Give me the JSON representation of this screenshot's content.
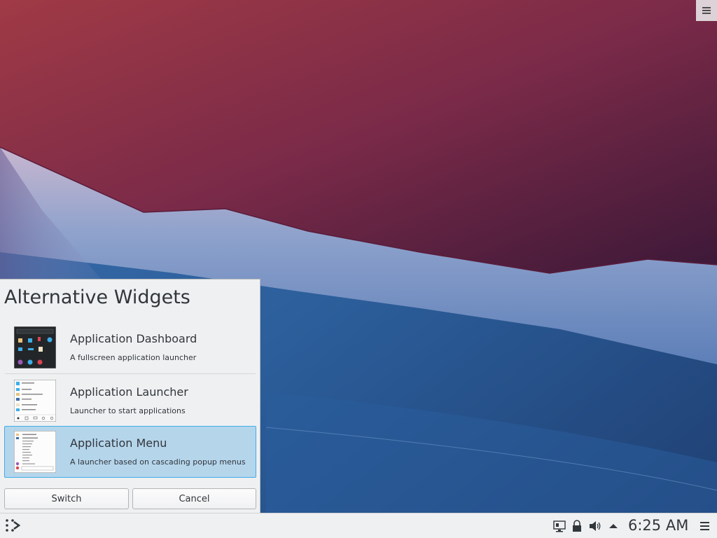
{
  "popup": {
    "title": "Alternative Widgets",
    "items": [
      {
        "name": "Application Dashboard",
        "description": "A fullscreen application launcher",
        "icon": "dashboard-thumbnail",
        "selected": false
      },
      {
        "name": "Application Launcher",
        "description": "Launcher to start applications",
        "icon": "launcher-thumbnail",
        "selected": false
      },
      {
        "name": "Application Menu",
        "description": "A launcher based on cascading popup menus",
        "icon": "menu-thumbnail",
        "selected": true
      }
    ],
    "switch_label": "Switch",
    "cancel_label": "Cancel"
  },
  "taskbar": {
    "launcher_icon": "plasma-launcher-icon",
    "tray_icons": [
      "network-icon",
      "lock-icon",
      "volume-icon",
      "expand-tray-icon"
    ],
    "clock": "6:25 AM",
    "menu_icon": "hamburger-icon"
  },
  "colors": {
    "selection_bg": "#b5d5eb",
    "selection_border": "#3daee9",
    "panel_bg": "#eff0f1",
    "text": "#31363b"
  }
}
